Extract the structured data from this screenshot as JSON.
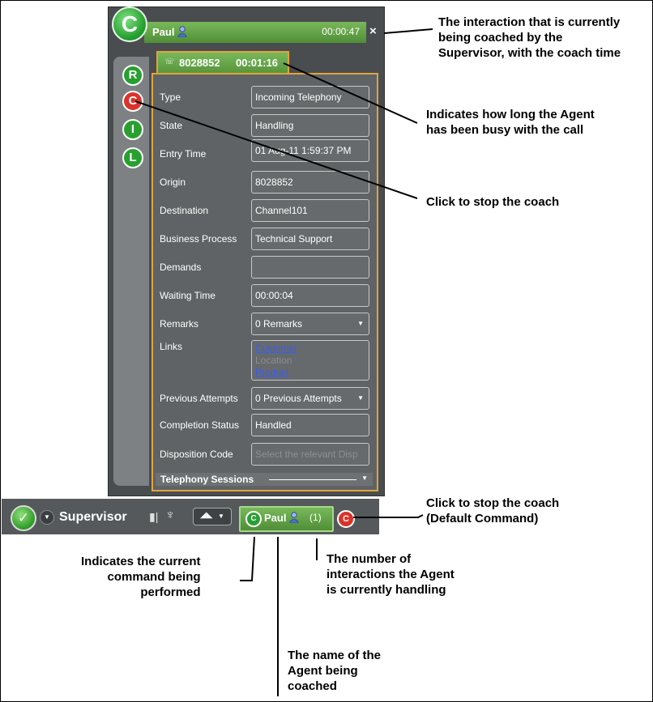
{
  "window": {
    "agent_name": "Paul",
    "coach_time": "00:00:47",
    "close_glyph": "×",
    "big_icon_letter": "C",
    "rail_icons": [
      {
        "letter": "R",
        "color": "#28a02f"
      },
      {
        "letter": "C",
        "color": "#d9342b"
      },
      {
        "letter": "I",
        "color": "#28a02f"
      },
      {
        "letter": "L",
        "color": "#28a02f"
      }
    ]
  },
  "tab": {
    "icon": "telephone-icon",
    "number": "8028852",
    "duration": "00:01:16"
  },
  "fields": {
    "type": {
      "label": "Type",
      "value": "Incoming Telephony"
    },
    "state": {
      "label": "State",
      "value": "Handling"
    },
    "entry_time": {
      "label": "Entry Time",
      "value": "01 Aug-11 1:59:37 PM"
    },
    "origin": {
      "label": "Origin",
      "value": "8028852"
    },
    "destination": {
      "label": "Destination",
      "value": "Channel101"
    },
    "business_process": {
      "label": "Business Process",
      "value": "Technical Support"
    },
    "demands": {
      "label": "Demands",
      "value": ""
    },
    "waiting_time": {
      "label": "Waiting Time",
      "value": "00:00:04"
    },
    "remarks": {
      "label": "Remarks",
      "value": "0 Remarks"
    },
    "links": {
      "label": "Links",
      "items": [
        "Customer",
        "Location",
        "Product"
      ]
    },
    "previous_attempts": {
      "label": "Previous Attempts",
      "value": "0 Previous Attempts"
    },
    "completion_status": {
      "label": "Completion Status",
      "value": "Handled"
    },
    "disposition_code": {
      "label": "Disposition Code",
      "placeholder": "Select the relevant Disp"
    }
  },
  "sessions": {
    "label": "Telephony Sessions"
  },
  "toolbar": {
    "role": "Supervisor",
    "active_letter": "C",
    "agent_name": "Paul",
    "count": "(1)",
    "stop_letter": "C"
  },
  "annotations": {
    "coached_interaction": "The interaction that is currently\nbeing coached by the\nSupervisor, with the coach time",
    "busy_duration": "Indicates how long the Agent\nhas been busy with the call",
    "stop_coach": "Click to stop the coach",
    "stop_coach_default": "Click to stop the coach\n(Default Command)",
    "current_command": "Indicates the current\ncommand being\nperformed",
    "interaction_count": "The number of\ninteractions the Agent\nis currently handling",
    "agent_name": "The name of the\nAgent being\ncoached"
  },
  "colors": {
    "green": "#28a02f",
    "red": "#d9342b",
    "panel_border": "#e1a43c",
    "window_bg": "#4a4d4f"
  }
}
